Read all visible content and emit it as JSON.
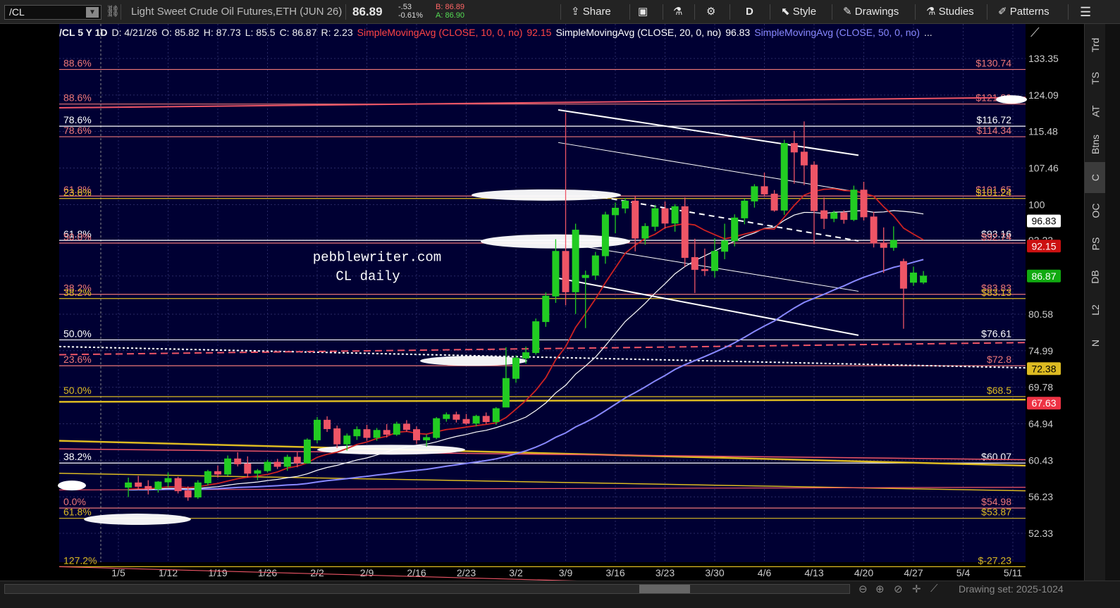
{
  "toolbar": {
    "symbol": "/CL",
    "instrument": "Light Sweet Crude Oil Futures,ETH (JUN 26)",
    "last": "86.89",
    "change": "-.53",
    "change_pct": "-0.61%",
    "bid": "B: 86.89",
    "ask": "A: 86.90",
    "share": "Share",
    "period": "D",
    "style": "Style",
    "drawings": "Drawings",
    "studies": "Studies",
    "patterns": "Patterns"
  },
  "header": {
    "symbol": "/CL 5 Y 1D",
    "date": "D: 4/21/26",
    "open": "O: 85.82",
    "high": "H: 87.73",
    "low": "L: 85.5",
    "close": "C: 86.87",
    "range": "R: 2.23",
    "sma10": "SimpleMovingAvg (CLOSE, 10, 0, no)",
    "sma10_val": "92.15",
    "sma20": "SimpleMovingAvg (CLOSE, 20, 0, no)",
    "sma20_val": "96.83",
    "sma50": "SimpleMovingAvg (CLOSE, 50, 0, no)",
    "more": "..."
  },
  "watermark": {
    "line1": "pebblewriter.com",
    "line2": "CL daily"
  },
  "sidebar": [
    "Trd",
    "TS",
    "AT",
    "Btns",
    "C",
    "OC",
    "PS",
    "DB",
    "L2",
    "N"
  ],
  "bottom": {
    "drawing_set": "Drawing set: 2025-1024"
  },
  "colors": {
    "bg": "#000033",
    "up": "#22cc22",
    "down": "#ee5566",
    "sma10": "#cc2222",
    "sma20": "#ffffff",
    "sma50": "#8888ff",
    "gold": "#ddbb22",
    "salmon": "#ee7777"
  },
  "chart_data": {
    "type": "candlestick",
    "x_ticks": [
      "1/5",
      "1/12",
      "1/19",
      "1/26",
      "2/2",
      "2/9",
      "2/16",
      "2/23",
      "3/2",
      "3/9",
      "3/16",
      "3/23",
      "3/30",
      "4/6",
      "4/13",
      "4/20",
      "4/27",
      "5/4",
      "5/11"
    ],
    "y_ticks": [
      "133.35",
      "124.09",
      "115.48",
      "107.46",
      "100",
      "93.23",
      "86.87",
      "80.58",
      "74.99",
      "69.78",
      "64.94",
      "60.43",
      "56.23",
      "52.33"
    ],
    "y_ticks_data": [
      133.35,
      124.09,
      115.48,
      107.46,
      100,
      93.23,
      86.87,
      80.58,
      74.99,
      69.78,
      64.94,
      60.43,
      56.23,
      52.33
    ],
    "ylim": [
      47,
      140
    ],
    "fib_levels": [
      {
        "left": "88.6%",
        "right": "$130.74",
        "price": 130.5,
        "color": "#ee7777"
      },
      {
        "left": "88.6%",
        "right": "$121.89",
        "price": 121.9,
        "color": "#ee7777"
      },
      {
        "left": "78.6%",
        "right": "$116.72",
        "price": 116.7,
        "color": "#ffffff"
      },
      {
        "left": "78.6%",
        "right": "$114.34",
        "price": 114.3,
        "color": "#ee7777"
      },
      {
        "left": "61.8%",
        "right": "$101.65",
        "price": 101.7,
        "color": "#ee7777"
      },
      {
        "left": "23.6%",
        "right": "$101.24",
        "price": 101.2,
        "color": "#ddbb22"
      },
      {
        "left": "61.8%",
        "right": "$93.16",
        "price": 93.2,
        "color": "#ffffff"
      },
      {
        "left": "50.0%",
        "right": "$92.74",
        "price": 92.7,
        "color": "#ee7777"
      },
      {
        "left": "38.2%",
        "right": "$83.83",
        "price": 83.8,
        "color": "#ee7777"
      },
      {
        "left": "38.2%",
        "right": "$83.13",
        "price": 83.1,
        "color": "#ddbb22"
      },
      {
        "left": "50.0%",
        "right": "$76.61",
        "price": 76.6,
        "color": "#ffffff"
      },
      {
        "left": "23.6%",
        "right": "$72.8",
        "price": 72.8,
        "color": "#ee7777"
      },
      {
        "left": "50.0%",
        "right": "$68.5",
        "price": 68.5,
        "color": "#ddbb22"
      },
      {
        "left": "38.2%",
        "right": "$60.07",
        "price": 60.1,
        "color": "#ffffff"
      },
      {
        "left": "0.0%",
        "right": "$54.98",
        "price": 55.0,
        "color": "#ee7777"
      },
      {
        "left": "61.8%",
        "right": "$53.87",
        "price": 53.9,
        "color": "#ddbb22"
      },
      {
        "left": "127.2%",
        "right": "$-27.23",
        "price": 49.0,
        "color": "#ddbb22"
      }
    ],
    "price_tags": [
      {
        "label": "96.83",
        "price": 96.83,
        "bg": "#ffffff",
        "fg": "#000000"
      },
      {
        "label": "92.15",
        "price": 92.15,
        "bg": "#cc1111",
        "fg": "#ffffff"
      },
      {
        "label": "86.87",
        "price": 86.87,
        "bg": "#11aa11",
        "fg": "#ffffff"
      },
      {
        "label": "72.38",
        "price": 72.38,
        "bg": "#ddbb22",
        "fg": "#000000"
      },
      {
        "label": "67.63",
        "price": 67.63,
        "bg": "#ee3344",
        "fg": "#ffffff"
      }
    ],
    "candles": [
      [
        57.3,
        58.4,
        56.2,
        57.8
      ],
      [
        57.8,
        58.6,
        57.0,
        57.4
      ],
      [
        57.4,
        58.1,
        56.5,
        57.1
      ],
      [
        57.1,
        58.0,
        56.7,
        57.9
      ],
      [
        57.9,
        59.0,
        57.3,
        58.3
      ],
      [
        58.3,
        58.5,
        56.6,
        56.9
      ],
      [
        56.9,
        57.4,
        55.8,
        56.2
      ],
      [
        56.2,
        58.1,
        56.0,
        57.8
      ],
      [
        57.8,
        59.3,
        57.5,
        59.1
      ],
      [
        59.1,
        59.8,
        58.4,
        58.8
      ],
      [
        58.8,
        61.0,
        58.6,
        60.6
      ],
      [
        60.6,
        61.4,
        59.7,
        60.0
      ],
      [
        60.0,
        60.9,
        58.4,
        58.9
      ],
      [
        58.9,
        59.4,
        58.1,
        59.2
      ],
      [
        59.2,
        60.5,
        59.0,
        60.2
      ],
      [
        60.2,
        60.6,
        59.4,
        59.7
      ],
      [
        59.7,
        61.1,
        59.2,
        60.8
      ],
      [
        60.8,
        61.4,
        59.6,
        60.1
      ],
      [
        60.1,
        63.1,
        60.0,
        62.9
      ],
      [
        62.9,
        65.8,
        62.5,
        65.4
      ],
      [
        65.4,
        65.9,
        63.9,
        64.3
      ],
      [
        64.3,
        64.7,
        61.9,
        62.4
      ],
      [
        62.4,
        63.7,
        61.6,
        63.4
      ],
      [
        63.4,
        64.6,
        62.9,
        64.2
      ],
      [
        64.2,
        64.8,
        62.8,
        63.2
      ],
      [
        63.2,
        64.4,
        62.8,
        64.1
      ],
      [
        64.1,
        64.9,
        63.2,
        63.6
      ],
      [
        63.6,
        65.2,
        63.4,
        64.9
      ],
      [
        64.9,
        65.4,
        63.9,
        64.2
      ],
      [
        64.2,
        64.6,
        62.4,
        62.9
      ],
      [
        62.9,
        63.6,
        62.1,
        63.2
      ],
      [
        63.2,
        65.8,
        63.0,
        65.6
      ],
      [
        65.6,
        66.4,
        65.2,
        66.1
      ],
      [
        66.1,
        66.5,
        65.1,
        65.5
      ],
      [
        65.5,
        66.2,
        64.8,
        65.0
      ],
      [
        65.0,
        66.1,
        64.6,
        65.9
      ],
      [
        65.9,
        66.4,
        64.9,
        65.2
      ],
      [
        65.2,
        67.1,
        64.8,
        66.9
      ],
      [
        67.1,
        75.5,
        69.8,
        71.0
      ],
      [
        71.0,
        74.3,
        70.4,
        73.9
      ],
      [
        73.9,
        75.6,
        73.1,
        74.7
      ],
      [
        74.7,
        79.9,
        74.4,
        79.4
      ],
      [
        79.4,
        84.1,
        78.6,
        83.5
      ],
      [
        83.5,
        93.4,
        82.4,
        91.2
      ],
      [
        91.2,
        119.8,
        82.0,
        84.2
      ],
      [
        84.2,
        96.3,
        80.6,
        95.1
      ],
      [
        86.6,
        87.8,
        78.4,
        87.0
      ],
      [
        87.0,
        91.1,
        86.2,
        90.4
      ],
      [
        90.4,
        98.6,
        89.0,
        98.0
      ],
      [
        98.0,
        100.4,
        94.5,
        99.3
      ],
      [
        99.3,
        101.3,
        98.3,
        100.7
      ],
      [
        100.7,
        101.8,
        91.2,
        93.6
      ],
      [
        93.6,
        96.4,
        92.4,
        95.8
      ],
      [
        95.8,
        99.9,
        94.9,
        99.2
      ],
      [
        99.2,
        100.6,
        95.4,
        96.4
      ],
      [
        96.4,
        100.1,
        94.8,
        99.6
      ],
      [
        99.6,
        101.4,
        88.5,
        90.1
      ],
      [
        90.1,
        93.5,
        84.0,
        88.0
      ],
      [
        88.0,
        91.7,
        86.9,
        87.8
      ],
      [
        87.8,
        93.6,
        86.6,
        91.2
      ],
      [
        91.2,
        96.3,
        89.8,
        93.1
      ],
      [
        93.1,
        98.1,
        92.1,
        97.4
      ],
      [
        97.4,
        101.2,
        96.2,
        100.7
      ],
      [
        100.7,
        104.1,
        99.4,
        103.6
      ],
      [
        103.6,
        106.5,
        101.7,
        102.1
      ],
      [
        102.1,
        102.9,
        98.6,
        98.9
      ],
      [
        98.9,
        113.6,
        98.0,
        112.8
      ],
      [
        112.8,
        115.6,
        104.2,
        110.9
      ],
      [
        110.9,
        117.8,
        103.9,
        108.1
      ],
      [
        108.1,
        108.9,
        92.5,
        98.8
      ],
      [
        98.8,
        101.4,
        95.3,
        97.3
      ],
      [
        97.3,
        98.8,
        96.6,
        98.4
      ],
      [
        98.4,
        98.9,
        96.3,
        97.1
      ],
      [
        97.1,
        103.8,
        96.8,
        102.9
      ],
      [
        102.9,
        104.6,
        96.9,
        97.6
      ],
      [
        97.6,
        98.6,
        91.9,
        92.7
      ],
      [
        92.7,
        95.6,
        87.4,
        91.9
      ],
      [
        91.9,
        95.8,
        91.3,
        93.2
      ],
      [
        89.4,
        89.9,
        78.3,
        84.8
      ],
      [
        85.8,
        88.5,
        85.2,
        87.4
      ],
      [
        85.82,
        87.73,
        85.5,
        86.87
      ]
    ]
  }
}
